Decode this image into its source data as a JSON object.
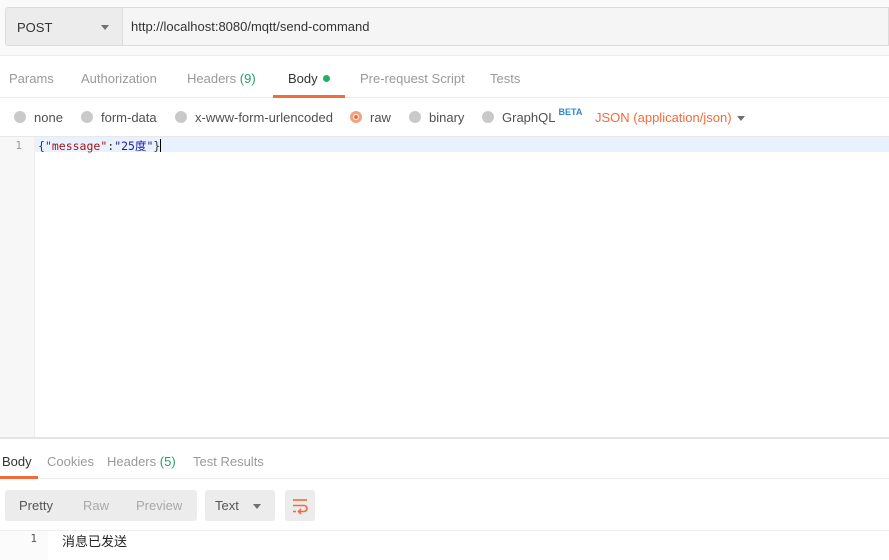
{
  "request": {
    "method": "POST",
    "url": "http://localhost:8080/mqtt/send-command"
  },
  "request_tabs": [
    {
      "label": "Params"
    },
    {
      "label": "Authorization"
    },
    {
      "label": "Headers",
      "count": "(9)"
    },
    {
      "label": "Body"
    },
    {
      "label": "Pre-request Script"
    },
    {
      "label": "Tests"
    }
  ],
  "body_types": [
    {
      "label": "none",
      "selected": false
    },
    {
      "label": "form-data",
      "selected": false
    },
    {
      "label": "x-www-form-urlencoded",
      "selected": false
    },
    {
      "label": "raw",
      "selected": true
    },
    {
      "label": "binary",
      "selected": false
    },
    {
      "label": "GraphQL",
      "badge": "BETA",
      "selected": false
    }
  ],
  "content_type": "JSON (application/json)",
  "editor": {
    "line_number": "1",
    "tokens": {
      "open": "{",
      "key": "\"message\"",
      "colon": ":",
      "value": "\"25度\"",
      "close": "}"
    }
  },
  "response_tabs": [
    {
      "label": "Body"
    },
    {
      "label": "Cookies"
    },
    {
      "label": "Headers",
      "count": "(5)"
    },
    {
      "label": "Test Results"
    }
  ],
  "response_toolbar": {
    "pretty": "Pretty",
    "raw": "Raw",
    "preview": "Preview",
    "format": "Text"
  },
  "response_body": {
    "line_number": "1",
    "text": "消息已发送"
  },
  "colors": {
    "accent": "#f26b3a",
    "green": "#27ae60",
    "count_green": "#26a26b",
    "beta_blue": "#2a88d6"
  },
  "icons": {
    "method_dropdown": "chevron-down-icon",
    "body_status": "green-dot-icon",
    "content_type_dropdown": "chevron-down-icon",
    "wrap": "wrap-lines-icon"
  }
}
